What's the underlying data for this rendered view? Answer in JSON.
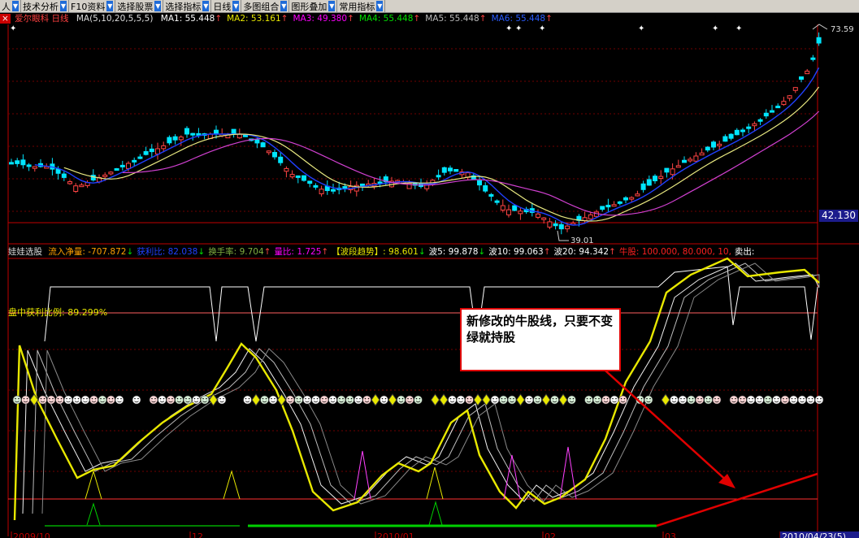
{
  "toolbar": [
    {
      "label": "人"
    },
    {
      "label": "技术分析"
    },
    {
      "label": "F10资料"
    },
    {
      "label": "选择股票"
    },
    {
      "label": "选择指标"
    },
    {
      "label": "日线"
    },
    {
      "label": "多图组合"
    },
    {
      "label": "图形叠加"
    },
    {
      "label": "常用指标"
    }
  ],
  "main": {
    "stock_name": "爱尔眼科",
    "period": "日线",
    "ma_params": "MA(5,10,20,5,5,5)",
    "ma_values": [
      {
        "label": "MA1: 55.448",
        "arrow": "↑",
        "color": "#ffffff"
      },
      {
        "label": "MA2: 53.161",
        "arrow": "↑",
        "color": "#e8e800"
      },
      {
        "label": "MA3: 49.380",
        "arrow": "↑",
        "color": "#ff00ff"
      },
      {
        "label": "MA4: 55.448",
        "arrow": "↑",
        "color": "#00e000"
      },
      {
        "label": "MA5: 55.448",
        "arrow": "↑",
        "color": "#bbbbbb"
      },
      {
        "label": "MA6: 55.448",
        "arrow": "↑",
        "color": "#2a5cff"
      }
    ],
    "high_label": "73.59",
    "low_label": "39.01",
    "price_box": "42.130",
    "colors": {
      "up": "#ff4444",
      "down": "#00e5ff",
      "ma5": "#2040ff",
      "ma10": "#e8e880",
      "ma20": "#d040d0"
    }
  },
  "indicator": {
    "name": "娃娃选股",
    "items": [
      {
        "label": "流入净量: -707.872",
        "arrow": "↓",
        "color": "#ffa000"
      },
      {
        "label": "获利比: 82.038",
        "arrow": "↓",
        "color": "#2040ff"
      },
      {
        "label": "换手率: 9.704",
        "arrow": "↑",
        "color": "#80b040"
      },
      {
        "label": "量比: 1.725",
        "arrow": "↑",
        "color": "#ff00ff"
      },
      {
        "label": "【波段趋势】: 98.601",
        "arrow": "↓",
        "color": "#e8e800"
      },
      {
        "label": "波5: 99.878",
        "arrow": "↓",
        "color": "#ffffff"
      },
      {
        "label": "波10: 99.063",
        "arrow": "↑",
        "color": "#ffffff"
      },
      {
        "label": "波20: 94.342",
        "arrow": "↑",
        "color": "#ffffff"
      },
      {
        "label": "牛股: 100.000, 80.000, 10,",
        "arrow": "",
        "color": "#ff2020"
      },
      {
        "label": "卖出: ",
        "arrow": "",
        "color": "#ffffff"
      }
    ],
    "yield_label": "盘中获利比例: 89.299%",
    "note": "新修改的牛股线，只要不变绿就持股"
  },
  "x_axis": [
    "2009/10",
    "12",
    "2010/01",
    "02",
    "03",
    "2010/04/23(5)"
  ]
}
